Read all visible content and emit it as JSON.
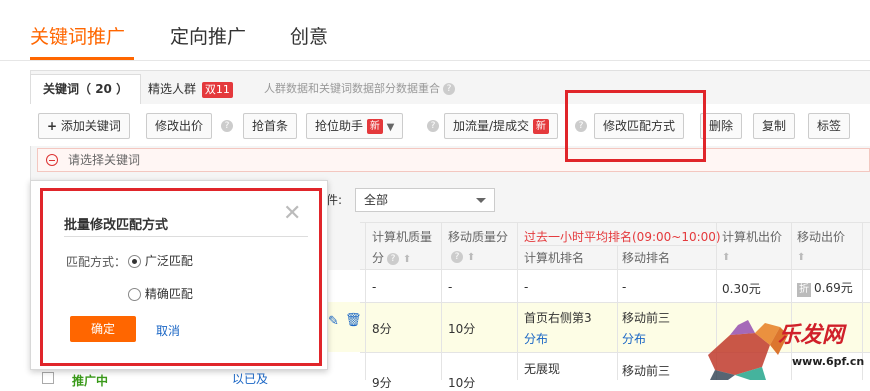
{
  "main_tabs": [
    {
      "label": "关键词推广"
    },
    {
      "label": "定向推广"
    },
    {
      "label": "创意"
    }
  ],
  "sub_tabs": {
    "keywords": {
      "label": "关键词",
      "count": "（ 20 ）"
    },
    "crowd": {
      "label": "精选人群",
      "badge": "双11"
    },
    "hint": "人群数据和关键词数据部分数据重合"
  },
  "toolbar": {
    "add_keyword": "添加关键词",
    "modify_bid": "修改出价",
    "grab_top": "抢首条",
    "rank_helper": "抢位助手",
    "new_badge": "新",
    "traffic": "加流量/提成交",
    "modify_match": "修改匹配方式",
    "delete": "删除",
    "copy": "复制",
    "tag": "标签"
  },
  "select_keyword_prompt": "请选择关键词",
  "filter": {
    "label_fragment": "件:",
    "value": "全部"
  },
  "table": {
    "headers": {
      "pc_quality_1": "计算机质量",
      "pc_quality_2": "分",
      "mobile_quality_1": "移动质量分",
      "avg_rank_title": "过去一小时平均排名(09:00~10:00)",
      "pc_rank": "计算机排名",
      "mobile_rank": "移动排名",
      "pc_bid": "计算机出价",
      "mobile_bid": "移动出价"
    },
    "rows": [
      {
        "pc_quality": "-",
        "mobile_quality": "-",
        "pc_rank": "-",
        "mobile_rank": "-",
        "pc_bid": "0.30元",
        "mobile_discount": "折",
        "mobile_bid": "0.69元"
      },
      {
        "pc_quality": "8分",
        "mobile_quality": "10分",
        "pc_rank": "首页右侧第3",
        "pc_rank_link": "分布",
        "mobile_rank": "移动前三",
        "mobile_rank_link": "分布"
      },
      {
        "status": "推广中",
        "partial_link": "以已及",
        "pc_quality": "9分",
        "mobile_quality": "10分",
        "pc_rank": "无展现",
        "mobile_rank": "移动前三"
      }
    ]
  },
  "popup": {
    "title": "批量修改匹配方式",
    "match_label": "匹配方式：",
    "options": [
      {
        "label": "广泛匹配",
        "selected": true
      },
      {
        "label": "精确匹配",
        "selected": false
      }
    ],
    "ok": "确定",
    "cancel": "取消"
  },
  "watermark": {
    "text": "乐发网",
    "url": "www.6pf.cn"
  },
  "colors": {
    "accent": "#ff6600",
    "highlight_border": "#e0252a",
    "link": "#1a66c5"
  }
}
